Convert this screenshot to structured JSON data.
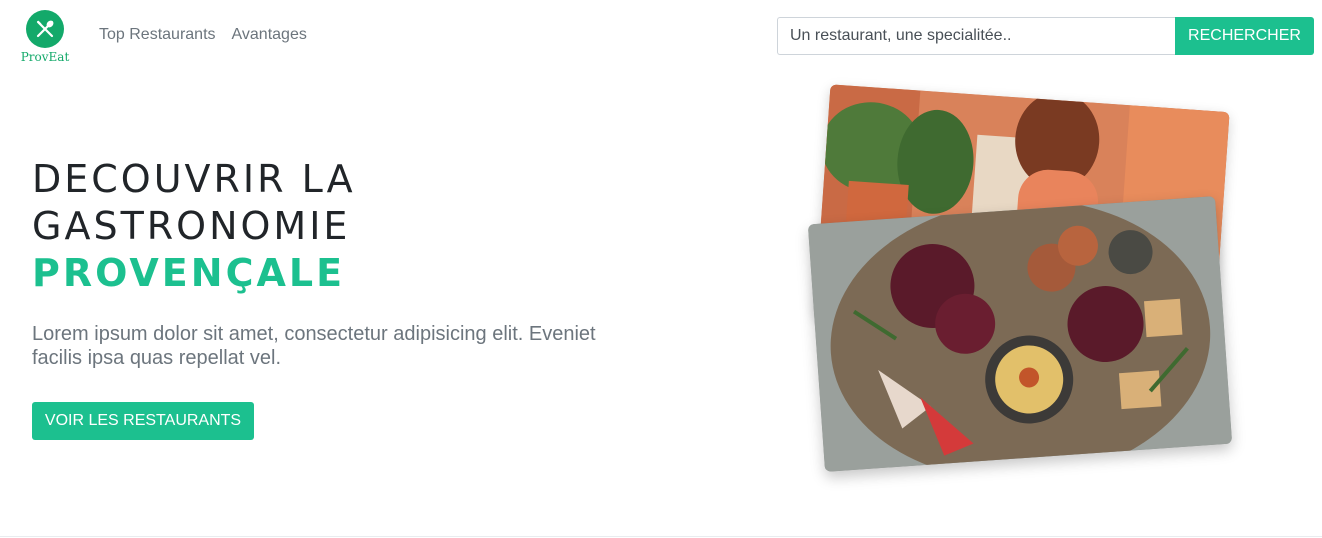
{
  "brand": {
    "name": "ProvEat",
    "icon": "utensils-icon"
  },
  "nav": {
    "links": [
      {
        "label": "Top Restaurants"
      },
      {
        "label": "Avantages"
      }
    ]
  },
  "search": {
    "placeholder": "Un restaurant, une specialitée..",
    "button_label": "RECHERCHER"
  },
  "hero": {
    "title_line1": "DECOUVRIR LA",
    "title_line2": "GASTRONOMIE",
    "title_accent": "PROVENÇALE",
    "lead": "Lorem ipsum dolor sit amet, consectetur adipisicing elit. Eveniet facilis ipsa quas repellat vel.",
    "cta_label": "VOIR LES RESTAURANTS"
  },
  "colors": {
    "accent": "#1cc08f",
    "brand_green": "#13a96a",
    "muted_text": "#6c757d"
  }
}
